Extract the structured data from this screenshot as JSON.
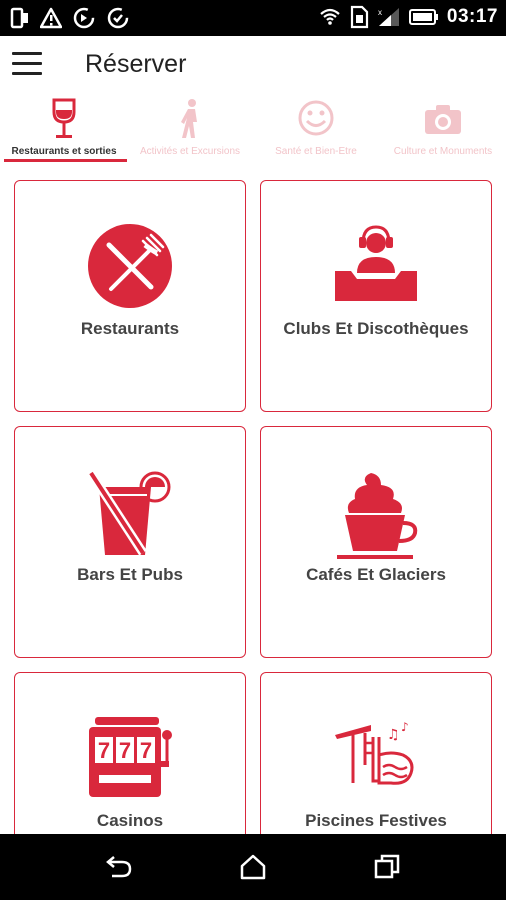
{
  "status_bar": {
    "time": "03:17",
    "icons": [
      "phone-icon",
      "warning-icon",
      "sync-icon",
      "sync-alt-icon",
      "wifi-icon",
      "sim-icon",
      "signal-icon",
      "battery-icon"
    ]
  },
  "app_bar": {
    "title": "Réserver",
    "menu_icon": "hamburger-menu-icon"
  },
  "tabs": [
    {
      "label": "Restaurants et sorties",
      "icon": "wine-glass-icon",
      "active": true
    },
    {
      "label": "Activités et Excursions",
      "icon": "walking-person-icon",
      "active": false
    },
    {
      "label": "Santé et Bien-Etre",
      "icon": "smiley-icon",
      "active": false
    },
    {
      "label": "Culture et Monuments",
      "icon": "camera-icon",
      "active": false
    }
  ],
  "categories": [
    {
      "label": "Restaurants",
      "icon": "fork-knife-icon"
    },
    {
      "label": "Clubs Et Discothèques",
      "icon": "dj-icon"
    },
    {
      "label": "Bars Et Pubs",
      "icon": "cocktail-glass-icon"
    },
    {
      "label": "Cafés Et Glaciers",
      "icon": "ice-cream-cup-icon"
    },
    {
      "label": "Casinos",
      "icon": "slot-machine-icon"
    },
    {
      "label": "Piscines Festives",
      "icon": "pool-party-icon"
    }
  ],
  "nav_bar": {
    "buttons": [
      "back-icon",
      "home-icon",
      "recents-icon"
    ]
  },
  "colors": {
    "accent": "#d9283c",
    "tab_inactive": "#f2c4c9",
    "text": "#444444"
  }
}
